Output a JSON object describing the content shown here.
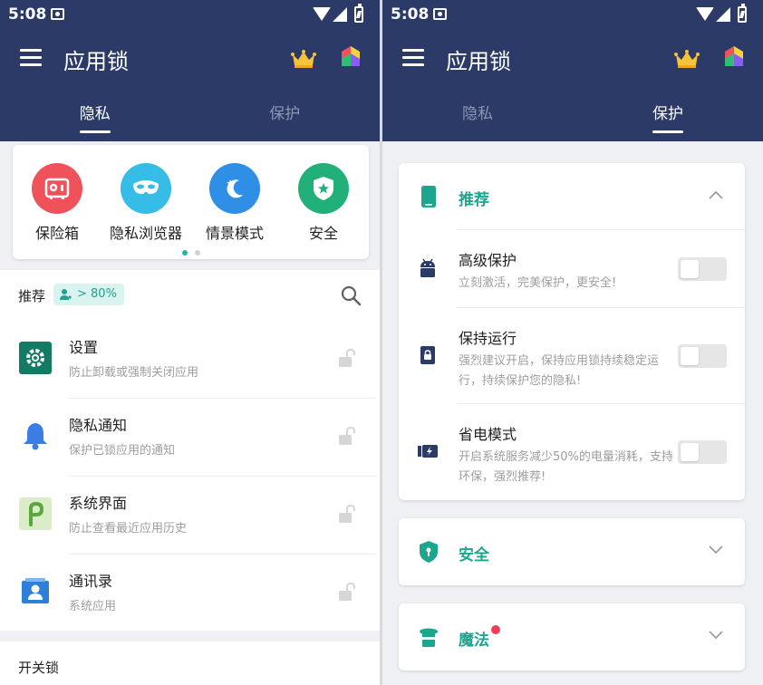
{
  "status_bar": {
    "time": "5:08"
  },
  "app": {
    "title": "应用锁"
  },
  "tabs": [
    {
      "label": "隐私"
    },
    {
      "label": "保护"
    }
  ],
  "features": [
    {
      "label": "保险箱",
      "color": "#f0525b"
    },
    {
      "label": "隐私浏览器",
      "color": "#35bde8"
    },
    {
      "label": "情景模式",
      "color": "#2f8fe6"
    },
    {
      "label": "安全",
      "color": "#22b07a"
    }
  ],
  "recommend": {
    "title": "推荐",
    "badge": "> 80%"
  },
  "apps": [
    {
      "name": "设置",
      "desc": "防止卸载或强制关闭应用",
      "icon": "gear-icon"
    },
    {
      "name": "隐私通知",
      "desc": "保护已锁应用的通知",
      "icon": "bell-icon"
    },
    {
      "name": "系统界面",
      "desc": "防止查看最近应用历史",
      "icon": "android-p-icon"
    },
    {
      "name": "通讯录",
      "desc": "系统应用",
      "icon": "contacts-icon"
    }
  ],
  "switch_lock": {
    "title": "开关锁"
  },
  "protect": {
    "recommend_title": "推荐",
    "settings": [
      {
        "title": "高级保护",
        "desc": "立刻激活，完美保护，更安全!",
        "enabled": false
      },
      {
        "title": "保持运行",
        "desc": "强烈建议开启，保持应用锁持续稳定运行，持续保护您的隐私!",
        "enabled": false
      },
      {
        "title": "省电模式",
        "desc": "开启系统服务减少50%的电量消耗，支持环保，强烈推荐!",
        "enabled": false
      }
    ],
    "security_title": "安全",
    "magic_title": "魔法"
  },
  "colors": {
    "header": "#2b3a67",
    "accent": "#1ea58e",
    "notification_dot": "#ef3d5a"
  }
}
